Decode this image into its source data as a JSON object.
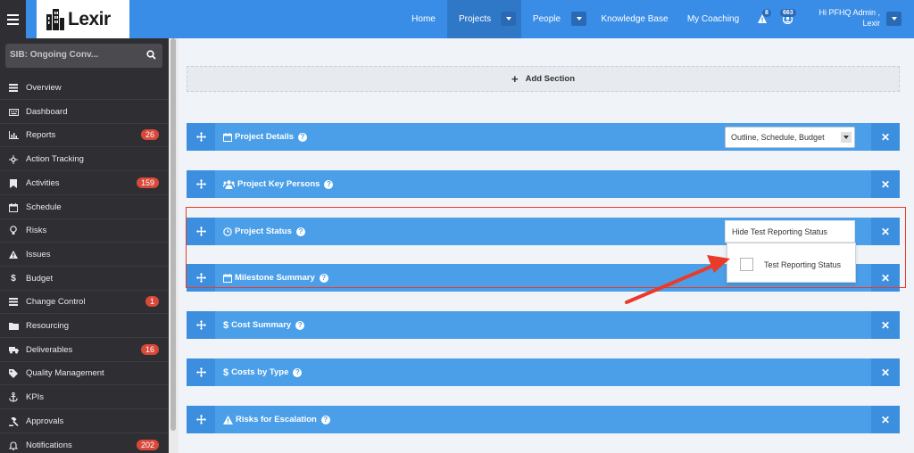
{
  "header": {
    "logo_text": "Lexir",
    "nav": {
      "home": "Home",
      "projects": "Projects",
      "people": "People",
      "knowledge_base": "Knowledge Base",
      "my_coaching": "My Coaching"
    },
    "alerts_count": "8",
    "messages_count": "663",
    "user_line1": "Hi PFHQ Admin ,",
    "user_line2": "Lexir"
  },
  "sidebar": {
    "search_text": "SIB: Ongoing Conv...",
    "items": [
      {
        "label": "Overview",
        "icon": "dashboard-icon"
      },
      {
        "label": "Dashboard",
        "icon": "keyboard-icon"
      },
      {
        "label": "Reports",
        "icon": "bar-chart-icon",
        "badge": "26"
      },
      {
        "label": "Action Tracking",
        "icon": "crosshair-icon"
      },
      {
        "label": "Activities",
        "icon": "bookmark-icon",
        "badge": "159"
      },
      {
        "label": "Schedule",
        "icon": "calendar-icon"
      },
      {
        "label": "Risks",
        "icon": "lightbulb-icon"
      },
      {
        "label": "Issues",
        "icon": "warning-icon"
      },
      {
        "label": "Budget",
        "icon": "dollar-icon"
      },
      {
        "label": "Change Control",
        "icon": "list-icon",
        "badge": "1"
      },
      {
        "label": "Resourcing",
        "icon": "folder-icon"
      },
      {
        "label": "Deliverables",
        "icon": "truck-icon",
        "badge": "16"
      },
      {
        "label": "Quality Management",
        "icon": "tag-icon"
      },
      {
        "label": "KPIs",
        "icon": "anchor-icon"
      },
      {
        "label": "Approvals",
        "icon": "gavel-icon"
      },
      {
        "label": "Notifications",
        "icon": "bell-icon",
        "badge": "202"
      }
    ]
  },
  "main": {
    "add_section_label": "Add Section",
    "sections": [
      {
        "title": "Project Details",
        "icon": "calendar-icon"
      },
      {
        "title": "Project Key Persons",
        "icon": "users-icon"
      },
      {
        "title": "Project Status",
        "icon": "clock-icon"
      },
      {
        "title": "Milestone Summary",
        "icon": "calendar-icon"
      },
      {
        "title": "Cost Summary",
        "icon": "dollar-icon"
      },
      {
        "title": "Costs by Type",
        "icon": "dollar-icon"
      },
      {
        "title": "Risks for Escalation",
        "icon": "warning-icon"
      }
    ],
    "project_details_select": "Outline, Schedule, Budget",
    "hide_button_label": "Hide Test Reporting Status",
    "dropdown_option": "Test Reporting Status",
    "highlight_color": "#ea3b2a"
  }
}
